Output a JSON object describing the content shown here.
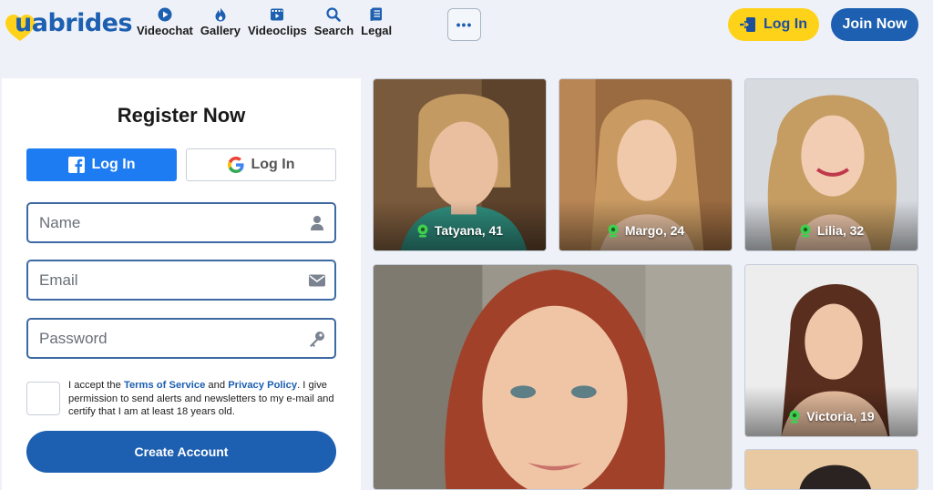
{
  "brand": {
    "logo_text": "uabrides",
    "accent": "#1d5fb0",
    "yellow": "#ffd21a"
  },
  "nav": [
    {
      "label": "Videochat",
      "icon": "play-circle-icon"
    },
    {
      "label": "Gallery",
      "icon": "flame-icon"
    },
    {
      "label": "Videoclips",
      "icon": "film-icon"
    },
    {
      "label": "Search",
      "icon": "search-icon"
    },
    {
      "label": "Legal",
      "icon": "document-icon"
    }
  ],
  "header": {
    "more_label": "•••",
    "login_label": "Log In",
    "join_label": "Join Now"
  },
  "register": {
    "title": "Register Now",
    "facebook_label": "Log In",
    "google_label": "Log In",
    "name_placeholder": "Name",
    "email_placeholder": "Email",
    "password_placeholder": "Password",
    "terms_pre": "I accept the ",
    "terms_link": "Terms of Service",
    "terms_mid": " and ",
    "privacy_link": "Privacy Policy",
    "terms_post": ". I give permission to send alerts and newsletters to my e-mail and certify that I am at least 18 years old.",
    "submit_label": "Create Account"
  },
  "profiles": [
    {
      "caption": "Tatyana, 41"
    },
    {
      "caption": "Margo, 24"
    },
    {
      "caption": "Lilia, 32"
    },
    {
      "caption": ""
    },
    {
      "caption": "Victoria, 19"
    },
    {
      "caption": ""
    }
  ]
}
